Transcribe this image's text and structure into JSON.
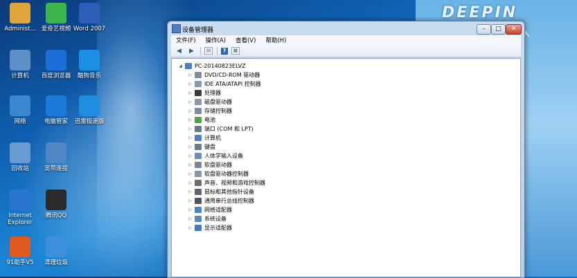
{
  "desktop": {
    "brand": "DEEPIN",
    "brand_sub": "深度技术 Ghost 系统 · 纯净安装",
    "icons": [
      {
        "label": "Administ...",
        "icon": "user-folder-icon",
        "color": "#e0a63a"
      },
      {
        "label": "爱奇艺视频",
        "icon": "iqiyi-icon",
        "color": "#3bb54a"
      },
      {
        "label": "Word 2007",
        "icon": "word-icon",
        "color": "#2b5eb7"
      },
      {
        "label": "计算机",
        "icon": "computer-icon",
        "color": "#5d8fc9"
      },
      {
        "label": "百度浏览器",
        "icon": "baidu-browser-icon",
        "color": "#1d6fd8"
      },
      {
        "label": "酷狗音乐",
        "icon": "kugou-icon",
        "color": "#1a8fe3"
      },
      {
        "label": "网络",
        "icon": "network-icon",
        "color": "#3a87cf"
      },
      {
        "label": "电脑管家",
        "icon": "shield-icon",
        "color": "#1c7bd9"
      },
      {
        "label": "迅雷极速版",
        "icon": "xunlei-icon",
        "color": "#1f8de0"
      },
      {
        "label": "回收站",
        "icon": "recycle-bin-icon",
        "color": "#6a9bd0"
      },
      {
        "label": "宽带连接",
        "icon": "broadband-icon",
        "color": "#4f86c6"
      },
      {
        "label": "Internet Explorer",
        "icon": "ie-icon",
        "color": "#2a75d0"
      },
      {
        "label": "腾讯QQ",
        "icon": "qq-icon",
        "color": "#2b2b2b"
      },
      {
        "label": "91助手V5",
        "icon": "91-assistant-icon",
        "color": "#e35b1c"
      },
      {
        "label": "清理垃圾",
        "icon": "cleanup-icon",
        "color": "#3c8fdc"
      }
    ]
  },
  "window": {
    "title": "设备管理器",
    "buttons": {
      "minimize": "–",
      "maximize": "□",
      "close": "✕"
    },
    "menu": [
      "文件(F)",
      "操作(A)",
      "查看(V)",
      "帮助(H)"
    ],
    "toolbar": {
      "back": "◀",
      "forward": "▶",
      "help": "?"
    },
    "tree": {
      "root": "PC-20140823ELVZ",
      "items": [
        {
          "label": "DVD/CD-ROM 驱动器",
          "icon": "cdrom-icon",
          "color": "#7f8c99"
        },
        {
          "label": "IDE ATA/ATAPI 控制器",
          "icon": "ide-controller-icon",
          "color": "#8a9aab"
        },
        {
          "label": "处理器",
          "icon": "processor-icon",
          "color": "#3a3a3a"
        },
        {
          "label": "磁盘驱动器",
          "icon": "disk-drive-icon",
          "color": "#8e98a4"
        },
        {
          "label": "存储控制器",
          "icon": "storage-controller-icon",
          "color": "#7d8b9a"
        },
        {
          "label": "电池",
          "icon": "battery-icon",
          "color": "#4aa84a"
        },
        {
          "label": "端口 (COM 和 LPT)",
          "icon": "port-icon",
          "color": "#6a7887"
        },
        {
          "label": "计算机",
          "icon": "computer-icon",
          "color": "#4f7fbf"
        },
        {
          "label": "键盘",
          "icon": "keyboard-icon",
          "color": "#6d7a88"
        },
        {
          "label": "人体学输入设备",
          "icon": "hid-icon",
          "color": "#6b8fb8"
        },
        {
          "label": "软盘驱动器",
          "icon": "floppy-drive-icon",
          "color": "#7b8794"
        },
        {
          "label": "软盘驱动器控制器",
          "icon": "floppy-controller-icon",
          "color": "#8796a5"
        },
        {
          "label": "声音、视频和游戏控制器",
          "icon": "sound-icon",
          "color": "#6a6f75"
        },
        {
          "label": "鼠标和其他指针设备",
          "icon": "mouse-icon",
          "color": "#5c6670"
        },
        {
          "label": "通用串行总线控制器",
          "icon": "usb-icon",
          "color": "#4b5560"
        },
        {
          "label": "网络适配器",
          "icon": "network-adapter-icon",
          "color": "#4a86c5"
        },
        {
          "label": "系统设备",
          "icon": "system-device-icon",
          "color": "#5a88c0"
        },
        {
          "label": "显示适配器",
          "icon": "display-adapter-icon",
          "color": "#3f78bd"
        }
      ]
    }
  }
}
